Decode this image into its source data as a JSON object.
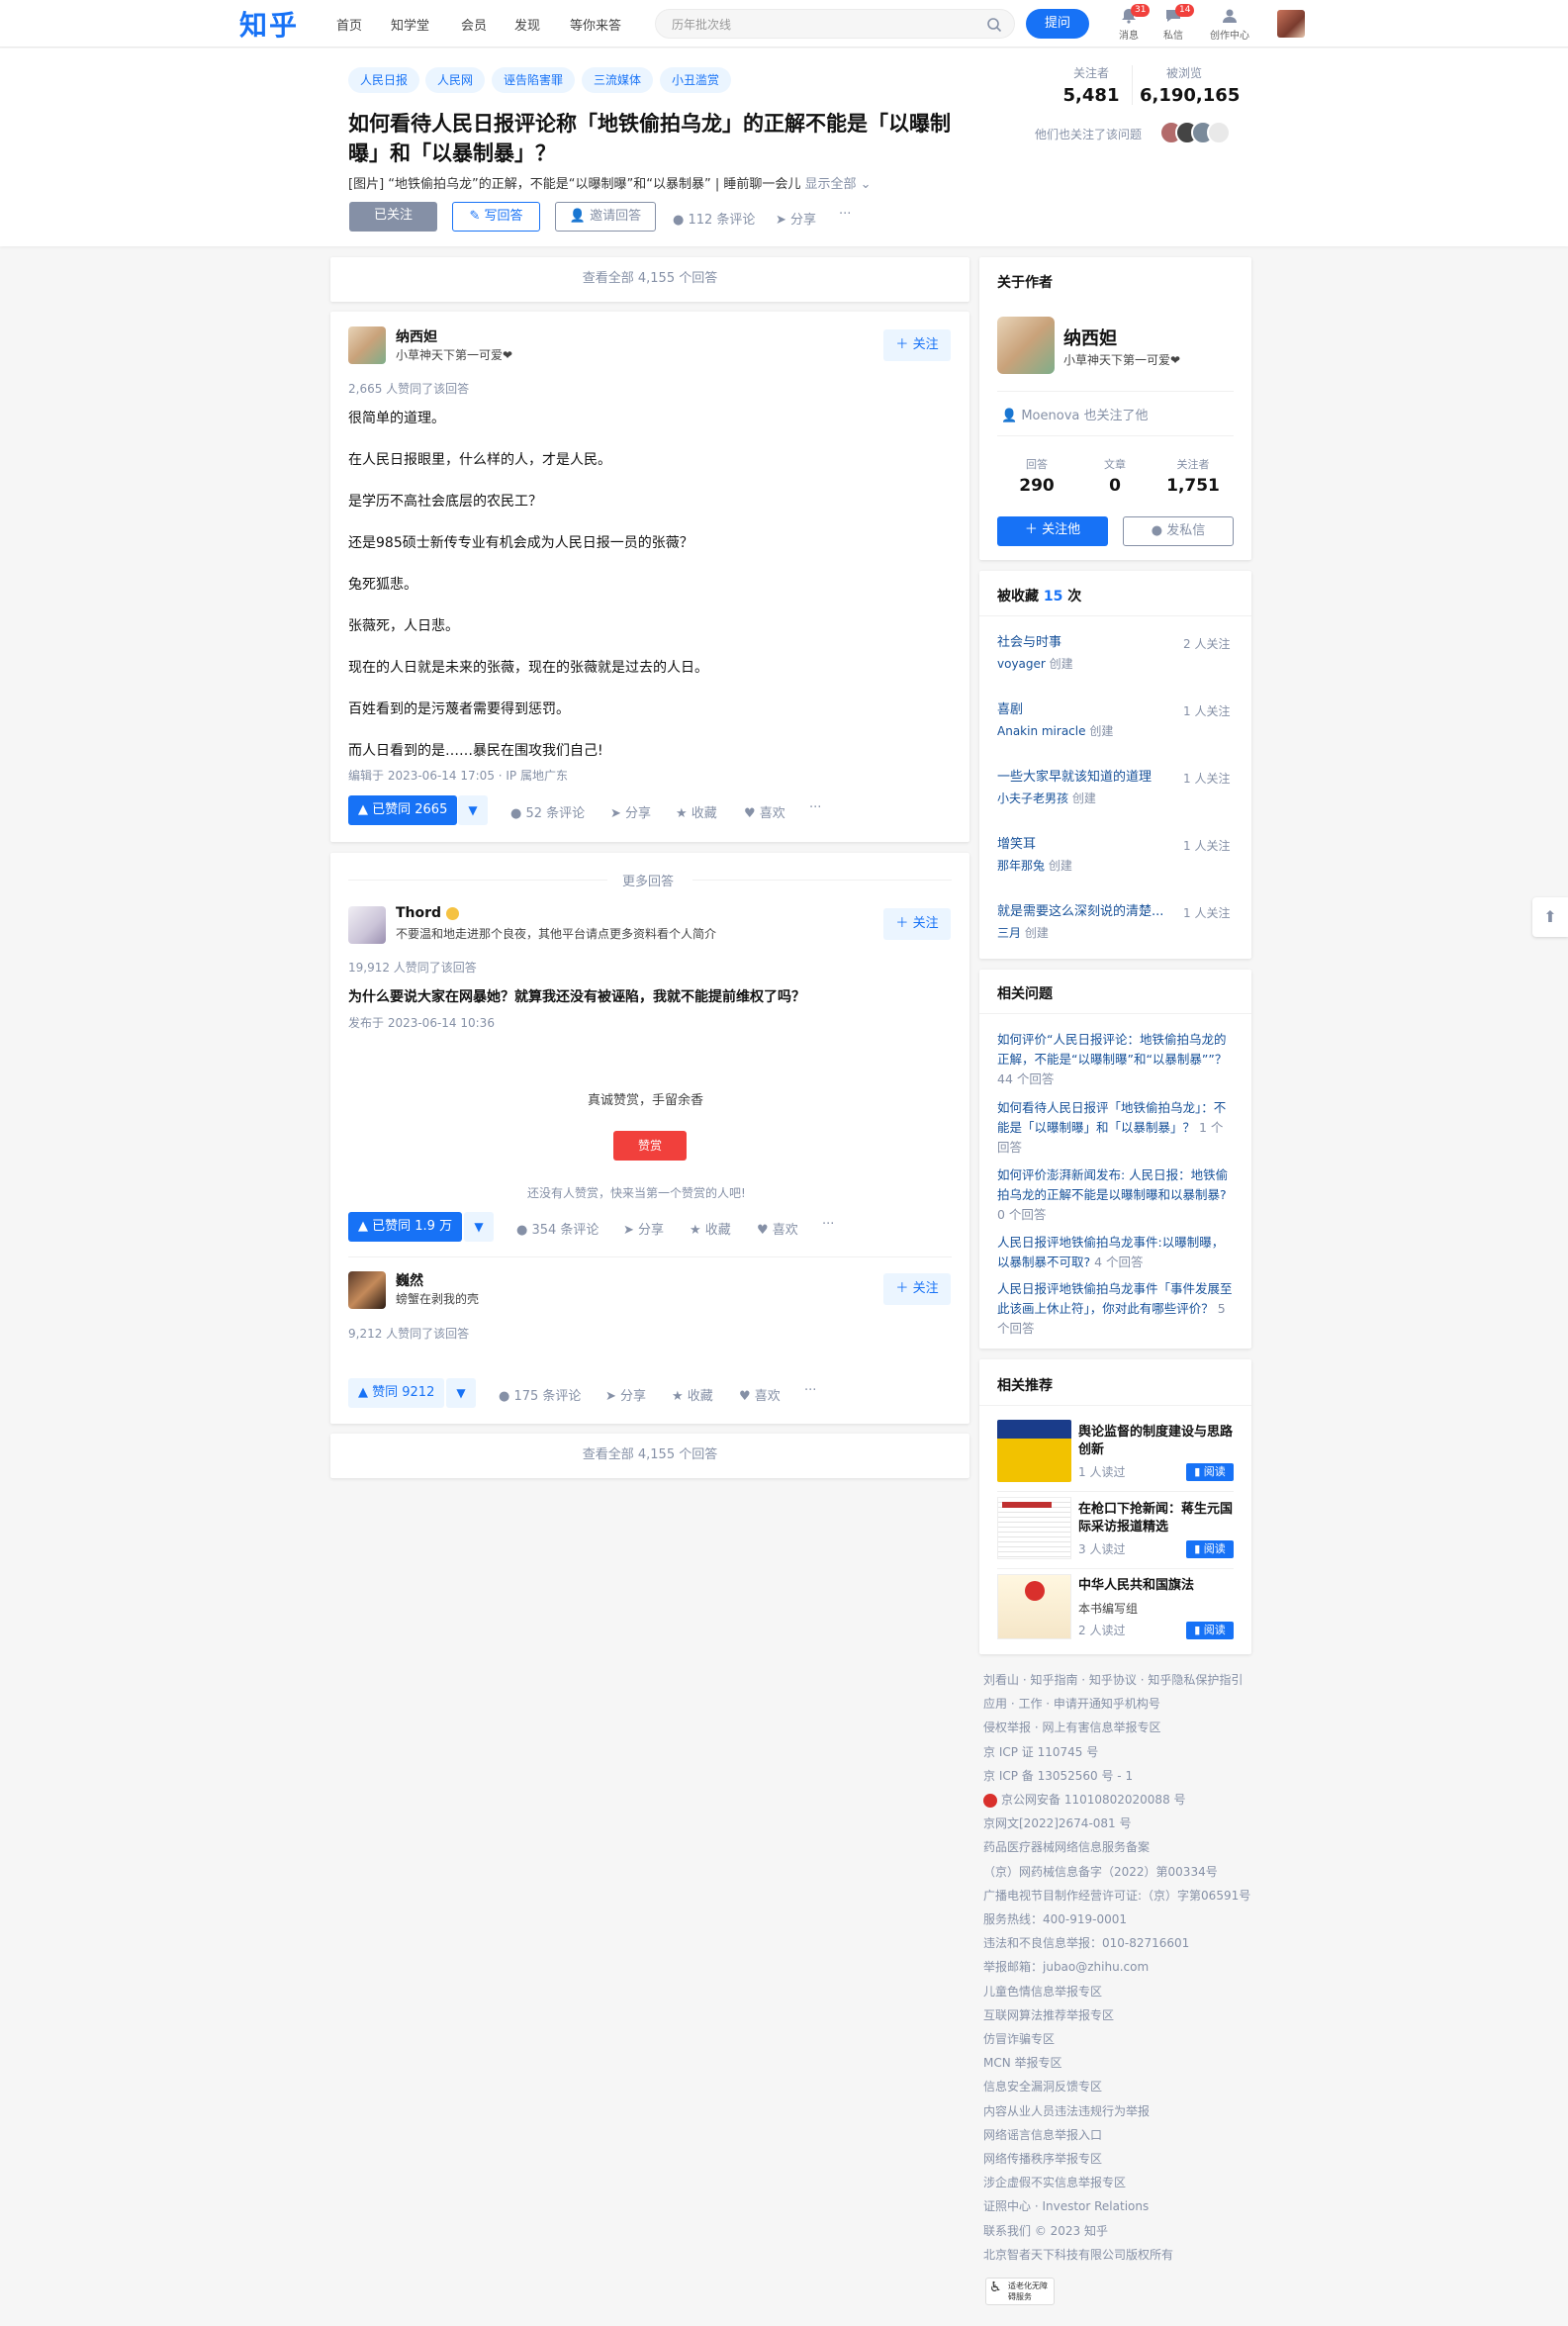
{
  "header": {
    "logo": "知乎",
    "nav": [
      "首页",
      "知学堂",
      "会员",
      "发现",
      "等你来答"
    ],
    "search_placeholder": "历年批次线",
    "ask_label": "提问",
    "icons": [
      {
        "label": "消息",
        "badge": "31",
        "icon": "bell-icon"
      },
      {
        "label": "私信",
        "badge": "14",
        "icon": "message-icon"
      },
      {
        "label": "创作中心",
        "badge": "",
        "icon": "creator-icon"
      }
    ]
  },
  "question": {
    "topics": [
      "人民日报",
      "人民网",
      "诬告陷害罪",
      "三流媒体",
      "小丑滥赏"
    ],
    "title": "如何看待人民日报评论称「地铁偷拍乌龙」的正解不能是「以曝制曝」和「以暴制暴」？",
    "description": "[图片] “地铁偷拍乌龙”的正解，不能是“以曝制曝”和“以暴制暴” | 睡前聊一会儿",
    "show_all": "显示全部",
    "followed_label": "已关注",
    "write_answer": "写回答",
    "invite": "邀请回答",
    "comments": "112 条评论",
    "share": "分享",
    "more": "···",
    "followers_label": "关注者",
    "followers": "5,481",
    "views_label": "被浏览",
    "views": "6,190,165",
    "also_followed": "他们也关注了该问题"
  },
  "view_all": "查看全部 4,155 个回答",
  "answer1": {
    "author": "纳西妲",
    "bio": "小草神天下第一可爱❤",
    "follow": "关注",
    "upvote_info": "2,665 人赞同了该回答",
    "paragraphs": [
      "很简单的道理。",
      "在人民日报眼里，什么样的人，才是人民。",
      "是学历不高社会底层的农民工？",
      "还是985硕士新传专业有机会成为人民日报一员的张薇？",
      "兔死狐悲。",
      "张薇死，人日悲。",
      "现在的人日就是未来的张薇，现在的张薇就是过去的人日。",
      "百姓看到的是污蔑者需要得到惩罚。",
      "而人日看到的是……暴民在围攻我们自己!"
    ],
    "edited": "编辑于 2023-06-14 17:05 · IP 属地广东",
    "vote": "▲ 已赞同 2665",
    "down": "▼",
    "comments": "52 条评论",
    "share": "分享",
    "collect": "收藏",
    "like": "喜欢",
    "more": "···"
  },
  "more_answers": "更多回答",
  "answer2": {
    "author": "Thord",
    "bio": "不要温和地走进那个良夜，其他平台请点更多资料看个人简介",
    "follow": "关注",
    "upvote_info": "19,912 人赞同了该回答",
    "title": "为什么要说大家在网暴她？就算我还没有被诬陷，我就不能提前维权了吗？",
    "published": "发布于 2023-06-14 10:36",
    "reward_text": "真诚赞赏，手留余香",
    "reward_button": "赞赏",
    "reward_none": "还没有人赞赏，快来当第一个赞赏的人吧!",
    "vote": "▲ 已赞同 1.9 万",
    "down": "▼",
    "comments": "354 条评论",
    "share": "分享",
    "collect": "收藏",
    "like": "喜欢",
    "more": "···"
  },
  "answer3": {
    "author": "巍然",
    "bio": "螃蟹在剥我的壳",
    "follow": "关注",
    "upvote_info": "9,212 人赞同了该回答",
    "vote": "▲ 赞同 9212",
    "down": "▼",
    "comments": "175 条评论",
    "share": "分享",
    "collect": "收藏",
    "like": "喜欢",
    "more": "···"
  },
  "about_author": {
    "title": "关于作者",
    "name": "纳西妲",
    "bio": "小草神天下第一可爱❤",
    "mutual": "Moenova 也关注了他",
    "answers_label": "回答",
    "answers": "290",
    "articles_label": "文章",
    "articles": "0",
    "followers_label": "关注者",
    "followers": "1,751",
    "follow_btn": "关注他",
    "msg_btn": "发私信"
  },
  "collections": {
    "title": "被收藏",
    "count": "15",
    "suffix": "次",
    "items": [
      {
        "name": "社会与时事",
        "creator": "voyager",
        "followers": "2 人关注"
      },
      {
        "name": "喜剧",
        "creator": "Anakin miracle",
        "followers": "1 人关注"
      },
      {
        "name": "一些大家早就该知道的道理",
        "creator": "小夫子老男孩",
        "followers": "1 人关注"
      },
      {
        "name": "增笑耳",
        "creator": "那年那兔",
        "followers": "1 人关注"
      },
      {
        "name": "就是需要这么深刻说的清楚...",
        "creator": "三月",
        "followers": "1 人关注"
      }
    ],
    "created": "创建"
  },
  "related_questions": {
    "title": "相关问题",
    "items": [
      {
        "q": "如何评价“人民日报评论：地铁偷拍乌龙的正解，不能是“以曝制曝”和“以暴制暴””？",
        "n": "44 个回答"
      },
      {
        "q": "如何看待人民日报评「地铁偷拍乌龙」：不能是「以曝制曝」和「以暴制暴」？",
        "n": "1 个回答"
      },
      {
        "q": "如何评价澎湃新闻发布: 人民日报：地铁偷拍乌龙的正解不能是以曝制曝和以暴制暴?",
        "n": "0 个回答"
      },
      {
        "q": "人民日报评地铁偷拍乌龙事件:以曝制曝，以暴制暴不可取?",
        "n": "4 个回答"
      },
      {
        "q": "人民日报评地铁偷拍乌龙事件「事件发展至此该画上休止符」，你对此有哪些评价？",
        "n": "5 个回答"
      }
    ]
  },
  "recommend": {
    "title": "相关推荐",
    "read": "阅读",
    "items": [
      {
        "title": "舆论监督的制度建设与思路创新",
        "meta": "1 人读过"
      },
      {
        "title": "在枪口下抢新闻：蒋生元国际采访报道精选",
        "meta": "3 人读过"
      },
      {
        "title": "中华人民共和国旗法",
        "meta": "本书编写组",
        "meta2": "2 人读过"
      }
    ]
  },
  "footer": [
    "刘看山 · 知乎指南 · 知乎协议 · 知乎隐私保护指引",
    "应用 · 工作 · 申请开通知乎机构号",
    "侵权举报 · 网上有害信息举报专区",
    "京 ICP 证 110745 号",
    "京 ICP 备 13052560 号 - 1",
    "京公网安备 11010802020088 号",
    "京网文[2022]2674-081 号",
    "药品医疗器械网络信息服务备案",
    "（京）网药械信息备字（2022）第00334号",
    "广播电视节目制作经营许可证:（京）字第06591号",
    "服务热线：400-919-0001",
    "违法和不良信息举报：010-82716601",
    "举报邮箱：jubao@zhihu.com",
    "儿童色情信息举报专区",
    "互联网算法推荐举报专区",
    "仿冒诈骗专区",
    "MCN 举报专区",
    "信息安全漏洞反馈专区",
    "内容从业人员违法违规行为举报",
    "网络谣言信息举报入口",
    "网络传播秩序举报专区",
    "涉企虚假不实信息举报专区",
    "证照中心 · Investor Relations",
    "联系我们 © 2023 知乎",
    "北京智者天下科技有限公司版权所有"
  ],
  "footer_badge": "适老化无障碍服务"
}
